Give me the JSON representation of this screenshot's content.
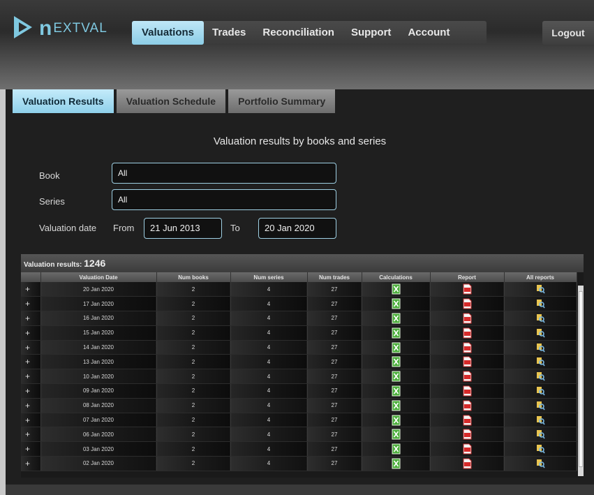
{
  "brand": {
    "word_big": "n",
    "word_rest": "EXTVAL",
    "colors": {
      "accent": "#8ccde6",
      "brand": "#7fc8e0"
    }
  },
  "nav": {
    "items": [
      {
        "label": "Valuations"
      },
      {
        "label": "Trades"
      },
      {
        "label": "Reconciliation"
      },
      {
        "label": "Support"
      },
      {
        "label": "Account"
      }
    ],
    "active": "Valuations",
    "logout": "Logout"
  },
  "tabs": [
    {
      "label": "Valuation Results"
    },
    {
      "label": "Valuation Schedule"
    },
    {
      "label": "Portfolio Summary"
    }
  ],
  "active_tab": "Valuation Results",
  "form": {
    "title": "Valuation results by books and series",
    "book_label": "Book",
    "book_value": "All",
    "series_label": "Series",
    "series_value": "All",
    "date_label": "Valuation date",
    "from_label": "From",
    "from_value": "21 Jun 2013",
    "to_label": "To",
    "to_value": "20 Jan 2020"
  },
  "results": {
    "label": "Valuation results:",
    "count": "1246",
    "columns": [
      "",
      "Valuation Date",
      "Num books",
      "Num series",
      "Num trades",
      "Calculations",
      "Report",
      "All reports"
    ],
    "rows": [
      {
        "date": "20 Jan 2020",
        "books": "2",
        "series": "4",
        "trades": "27"
      },
      {
        "date": "17 Jan 2020",
        "books": "2",
        "series": "4",
        "trades": "27"
      },
      {
        "date": "16 Jan 2020",
        "books": "2",
        "series": "4",
        "trades": "27"
      },
      {
        "date": "15 Jan 2020",
        "books": "2",
        "series": "4",
        "trades": "27"
      },
      {
        "date": "14 Jan 2020",
        "books": "2",
        "series": "4",
        "trades": "27"
      },
      {
        "date": "13 Jan 2020",
        "books": "2",
        "series": "4",
        "trades": "27"
      },
      {
        "date": "10 Jan 2020",
        "books": "2",
        "series": "4",
        "trades": "27"
      },
      {
        "date": "09 Jan 2020",
        "books": "2",
        "series": "4",
        "trades": "27"
      },
      {
        "date": "08 Jan 2020",
        "books": "2",
        "series": "4",
        "trades": "27"
      },
      {
        "date": "07 Jan 2020",
        "books": "2",
        "series": "4",
        "trades": "27"
      },
      {
        "date": "06 Jan 2020",
        "books": "2",
        "series": "4",
        "trades": "27"
      },
      {
        "date": "03 Jan 2020",
        "books": "2",
        "series": "4",
        "trades": "27"
      },
      {
        "date": "02 Jan 2020",
        "books": "2",
        "series": "4",
        "trades": "27"
      }
    ],
    "row_icons": {
      "calculations": "excel-file-icon",
      "report": "pdf-file-icon",
      "all_reports": "search-reports-icon"
    }
  }
}
